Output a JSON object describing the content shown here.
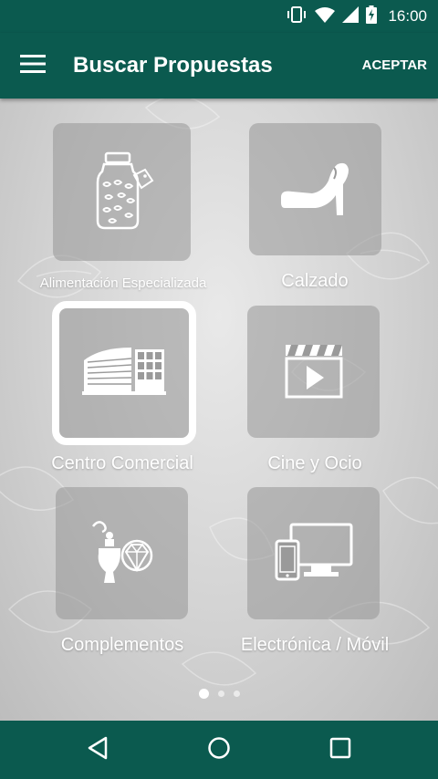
{
  "status_bar": {
    "time": "16:00",
    "icons": [
      "vibrate-icon",
      "wifi-icon",
      "signal-icon",
      "battery-charging-icon"
    ]
  },
  "app_bar": {
    "menu_icon": "hamburger-menu-icon",
    "title": "Buscar Propuestas",
    "accept_label": "ACEPTAR"
  },
  "categories": [
    {
      "label": "Alimentación Especializada",
      "icon": "jar-icon",
      "selected": false
    },
    {
      "label": "Calzado",
      "icon": "high-heel-icon",
      "selected": false
    },
    {
      "label": "Centro Comercial",
      "icon": "mall-building-icon",
      "selected": true
    },
    {
      "label": "Cine y Ocio",
      "icon": "clapperboard-play-icon",
      "selected": false
    },
    {
      "label": "Complementos",
      "icon": "perfume-diamond-icon",
      "selected": false
    },
    {
      "label": "Electrónica / Móvil",
      "icon": "phone-monitor-icon",
      "selected": false
    }
  ],
  "pagination": {
    "total": 3,
    "current": 1
  },
  "nav_bar": {
    "buttons": [
      "back-icon",
      "home-icon",
      "recents-icon"
    ]
  },
  "colors": {
    "primary": "#0b5a4f",
    "tile": "#9a9a9a",
    "text": "#ffffff"
  }
}
